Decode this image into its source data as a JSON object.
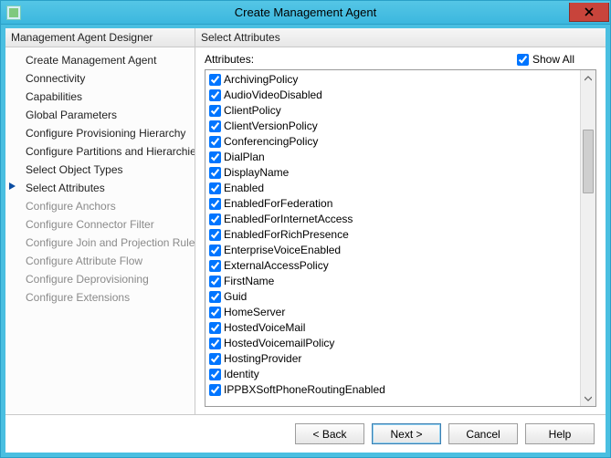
{
  "window": {
    "title": "Create Management Agent"
  },
  "nav": {
    "header": "Management Agent Designer",
    "items": [
      {
        "label": "Create Management Agent",
        "state": "done"
      },
      {
        "label": "Connectivity",
        "state": "done"
      },
      {
        "label": "Capabilities",
        "state": "done"
      },
      {
        "label": "Global Parameters",
        "state": "done"
      },
      {
        "label": "Configure Provisioning Hierarchy",
        "state": "done"
      },
      {
        "label": "Configure Partitions and Hierarchies",
        "state": "done"
      },
      {
        "label": "Select Object Types",
        "state": "done"
      },
      {
        "label": "Select Attributes",
        "state": "current"
      },
      {
        "label": "Configure Anchors",
        "state": "disabled"
      },
      {
        "label": "Configure Connector Filter",
        "state": "disabled"
      },
      {
        "label": "Configure Join and Projection Rules",
        "state": "disabled"
      },
      {
        "label": "Configure Attribute Flow",
        "state": "disabled"
      },
      {
        "label": "Configure Deprovisioning",
        "state": "disabled"
      },
      {
        "label": "Configure Extensions",
        "state": "disabled"
      }
    ]
  },
  "panel": {
    "header": "Select Attributes",
    "attributes_label": "Attributes:",
    "show_all_label": "Show All",
    "show_all_checked": true
  },
  "attributes": [
    {
      "label": "ArchivingPolicy",
      "checked": true
    },
    {
      "label": "AudioVideoDisabled",
      "checked": true
    },
    {
      "label": "ClientPolicy",
      "checked": true
    },
    {
      "label": "ClientVersionPolicy",
      "checked": true
    },
    {
      "label": "ConferencingPolicy",
      "checked": true
    },
    {
      "label": "DialPlan",
      "checked": true
    },
    {
      "label": "DisplayName",
      "checked": true
    },
    {
      "label": "Enabled",
      "checked": true
    },
    {
      "label": "EnabledForFederation",
      "checked": true
    },
    {
      "label": "EnabledForInternetAccess",
      "checked": true
    },
    {
      "label": "EnabledForRichPresence",
      "checked": true
    },
    {
      "label": "EnterpriseVoiceEnabled",
      "checked": true
    },
    {
      "label": "ExternalAccessPolicy",
      "checked": true
    },
    {
      "label": "FirstName",
      "checked": true
    },
    {
      "label": "Guid",
      "checked": true
    },
    {
      "label": "HomeServer",
      "checked": true
    },
    {
      "label": "HostedVoiceMail",
      "checked": true
    },
    {
      "label": "HostedVoicemailPolicy",
      "checked": true
    },
    {
      "label": "HostingProvider",
      "checked": true
    },
    {
      "label": "Identity",
      "checked": true
    },
    {
      "label": "IPPBXSoftPhoneRoutingEnabled",
      "checked": true
    }
  ],
  "buttons": {
    "back": "<  Back",
    "next": "Next  >",
    "cancel": "Cancel",
    "help": "Help"
  }
}
